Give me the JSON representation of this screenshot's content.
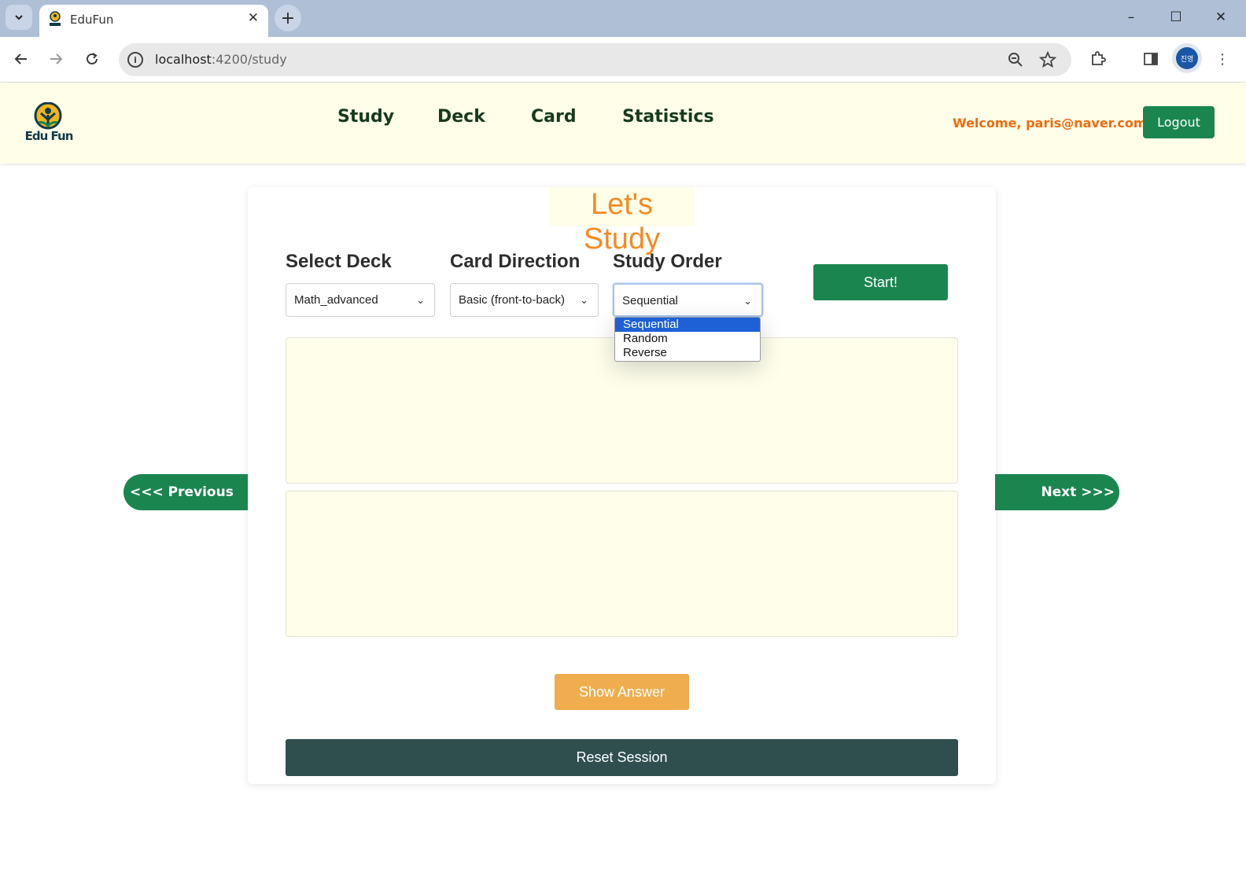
{
  "browser": {
    "tab_title": "EduFun",
    "new_tab_icon": "+",
    "url_host": "localhost",
    "url_path": ":4200/study",
    "profile_initials": "진영",
    "win_minimize": "–",
    "win_maximize": "☐",
    "win_close": "✕"
  },
  "header": {
    "logo_text": "Edu Fun",
    "nav": [
      "Study",
      "Deck",
      "Card",
      "Statistics"
    ],
    "welcome": "Welcome, paris@naver.com!",
    "logout_label": "Logout"
  },
  "study": {
    "title": "Let's Study",
    "deck_label": "Select Deck",
    "deck_value": "Math_advanced",
    "direction_label": "Card Direction",
    "direction_value": "Basic (front-to-back)",
    "order_label": "Study Order",
    "order_value": "Sequential",
    "order_options": [
      "Sequential",
      "Random",
      "Reverse"
    ],
    "start_label": "Start!",
    "prev_label": "<<< Previous",
    "next_label": "Next >>>",
    "show_answer_label": "Show Answer",
    "reset_label": "Reset Session"
  },
  "colors": {
    "brand_green": "#1b8550",
    "header_bg": "#fefee9",
    "title_orange": "#f58a1f",
    "welcome_orange": "#f06a10",
    "show_answer": "#f0ad4e",
    "reset": "#2f4f4f",
    "dropdown_selected": "#1e60d6"
  }
}
